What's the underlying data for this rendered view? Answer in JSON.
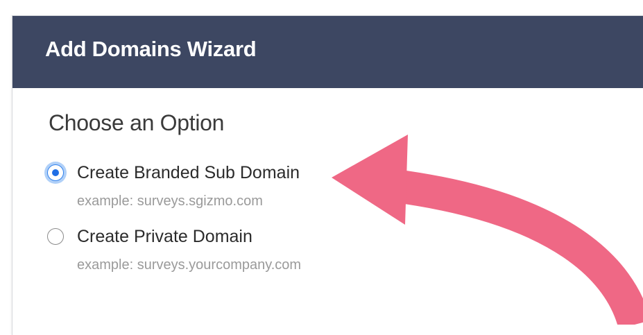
{
  "wizard": {
    "title": "Add Domains Wizard"
  },
  "section": {
    "title": "Choose an Option"
  },
  "options": [
    {
      "label": "Create Branded Sub Domain",
      "example": "example: surveys.sgizmo.com",
      "selected": true
    },
    {
      "label": "Create Private Domain",
      "example": "example: surveys.yourcompany.com",
      "selected": false
    }
  ],
  "annotation": {
    "arrow_color": "#ef6885"
  },
  "colors": {
    "header_bg": "#3d4762",
    "radio_selected": "#1f6ee5"
  }
}
